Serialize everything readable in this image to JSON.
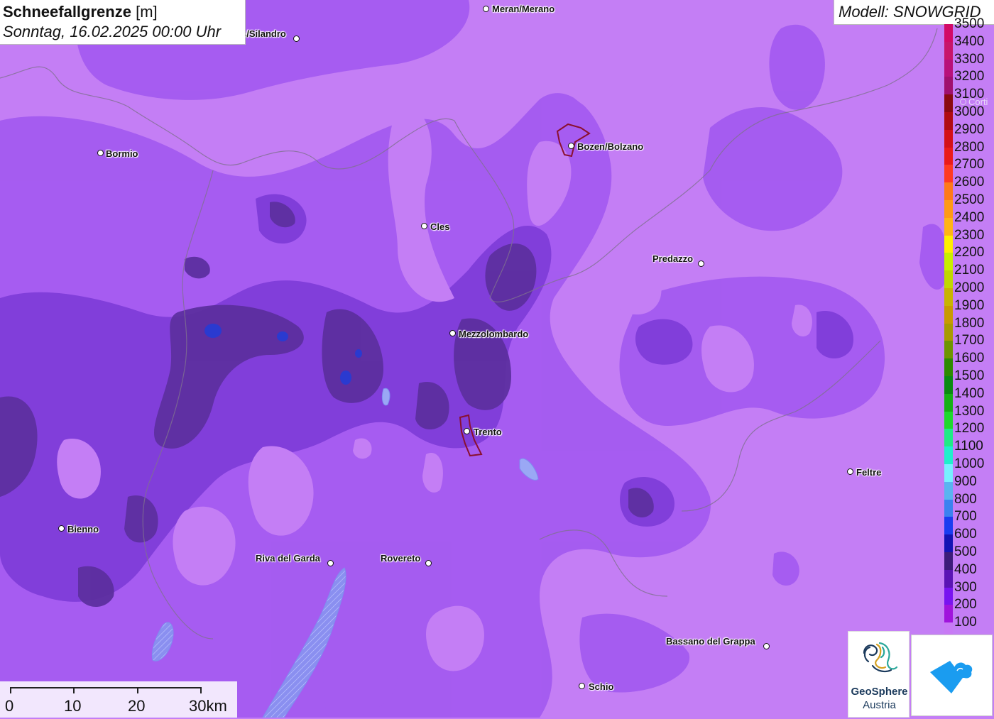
{
  "title": {
    "name": "Schneefallgrenze",
    "unit": "[m]",
    "date": "Sonntag, 16.02.2025 00:00 Uhr"
  },
  "model": "Modell: SNOWGRID",
  "legend": [
    {
      "label": "3500",
      "color": "#d20a66"
    },
    {
      "label": "3400",
      "color": "#c8156b"
    },
    {
      "label": "3300",
      "color": "#b8107a"
    },
    {
      "label": "3200",
      "color": "#a0106e"
    },
    {
      "label": "3100",
      "color": "#8a0a10"
    },
    {
      "label": "3000",
      "color": "#b00c12"
    },
    {
      "label": "2900",
      "color": "#d41018"
    },
    {
      "label": "2800",
      "color": "#ea1a1a"
    },
    {
      "label": "2700",
      "color": "#ff3a22"
    },
    {
      "label": "2600",
      "color": "#ff7a1a"
    },
    {
      "label": "2500",
      "color": "#ff9a14"
    },
    {
      "label": "2400",
      "color": "#ffb414"
    },
    {
      "label": "2300",
      "color": "#ffee00"
    },
    {
      "label": "2200",
      "color": "#c8f000"
    },
    {
      "label": "2100",
      "color": "#c0d800"
    },
    {
      "label": "2000",
      "color": "#c8b400"
    },
    {
      "label": "1900",
      "color": "#c89a00"
    },
    {
      "label": "1800",
      "color": "#a89a00"
    },
    {
      "label": "1700",
      "color": "#6e9400"
    },
    {
      "label": "1600",
      "color": "#2e8a00"
    },
    {
      "label": "1500",
      "color": "#0a8a12"
    },
    {
      "label": "1400",
      "color": "#16b016"
    },
    {
      "label": "1300",
      "color": "#1ed82e"
    },
    {
      "label": "1200",
      "color": "#1eeb86"
    },
    {
      "label": "1100",
      "color": "#1ef0cc"
    },
    {
      "label": "1000",
      "color": "#78f0ff"
    },
    {
      "label": "900",
      "color": "#5ab4f0"
    },
    {
      "label": "800",
      "color": "#3a82f0"
    },
    {
      "label": "700",
      "color": "#1a3cf0"
    },
    {
      "label": "600",
      "color": "#1414b4"
    },
    {
      "label": "500",
      "color": "#3c1c7a"
    },
    {
      "label": "400",
      "color": "#5a14b4"
    },
    {
      "label": "300",
      "color": "#7814f0"
    },
    {
      "label": "200",
      "color": "#a014dc"
    },
    {
      "label": "100",
      "color": "#c87af5"
    }
  ],
  "cities": [
    {
      "name": "Meran/Merano",
      "id": "meran"
    },
    {
      "name": "s/Silandro",
      "id": "silandro"
    },
    {
      "name": "Bormio",
      "id": "bormio"
    },
    {
      "name": "Bozen/Bolzano",
      "id": "bozen"
    },
    {
      "name": "Cles",
      "id": "cles"
    },
    {
      "name": "Predazzo",
      "id": "predazzo"
    },
    {
      "name": "Mezzolombardo",
      "id": "mezzolombardo"
    },
    {
      "name": "Trento",
      "id": "trento"
    },
    {
      "name": "Feltre",
      "id": "feltre"
    },
    {
      "name": "Bienno",
      "id": "bienno"
    },
    {
      "name": "Riva del Garda",
      "id": "riva"
    },
    {
      "name": "Rovereto",
      "id": "rovereto"
    },
    {
      "name": "Bassano del Grappa",
      "id": "bassano"
    },
    {
      "name": "Schio",
      "id": "schio"
    },
    {
      "name": "Corti",
      "id": "cortina"
    }
  ],
  "scale": {
    "labels": [
      "0",
      "10",
      "20",
      "30km"
    ]
  },
  "logo": {
    "line1": "GeoSphere",
    "line2": "Austria"
  },
  "colors": {
    "base": "#c47ef5",
    "mid": "#a55cf0",
    "dark": "#7a38d0",
    "darker": "#5a2e9a",
    "deep": "#3c1c7a",
    "blue": "#2030c8",
    "water": "#8fa0f0"
  }
}
